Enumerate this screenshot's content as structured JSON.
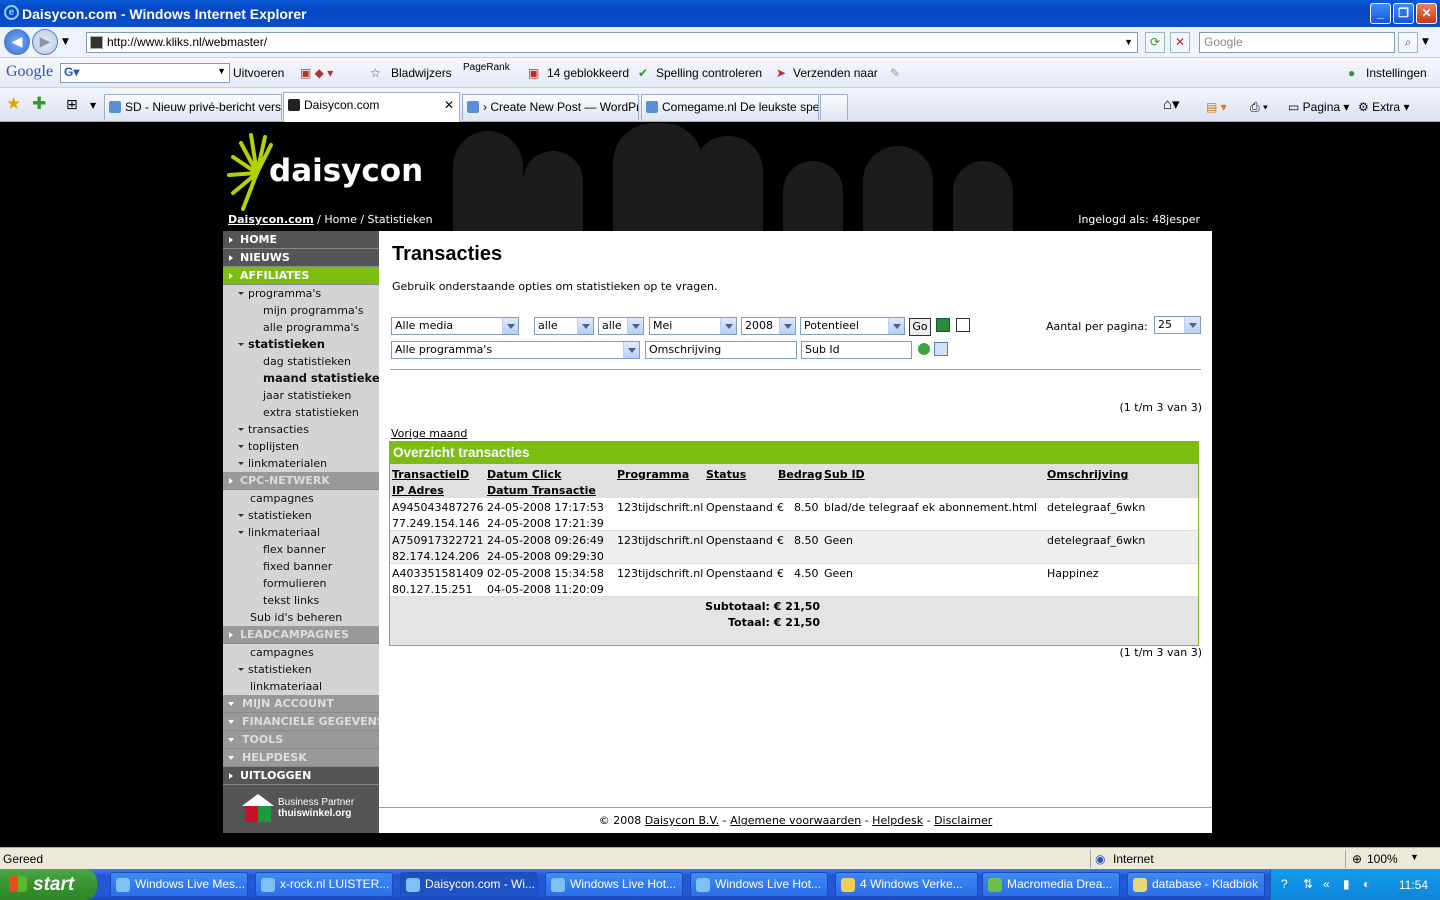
{
  "window": {
    "title": "Daisycon.com - Windows Internet Explorer",
    "url": "http://www.kliks.nl/webmaster/",
    "search_placeholder": "Google"
  },
  "google_toolbar": {
    "logo": "Google",
    "uitvoeren": "Uitvoeren",
    "bladwijzers": "Bladwijzers",
    "pagerank": "PageRank",
    "geblokkeerd": "14 geblokkeerd",
    "spelling": "Spelling controleren",
    "verzenden": "Verzenden naar",
    "instellingen": "Instellingen"
  },
  "tabs": [
    {
      "label": "SD - Nieuw privé-bericht vers..."
    },
    {
      "label": "Daisycon.com"
    },
    {
      "label": "› Create New Post — WordPr..."
    },
    {
      "label": "Comegame.nl De leukste spel..."
    }
  ],
  "tab_tools": {
    "pagina": "Pagina",
    "extra": "Extra"
  },
  "header": {
    "logo": "daisycon",
    "crumb_home_link": "Daisycon.com",
    "crumb_sep": " / ",
    "crumb_rest": "Home / Statistieken",
    "ingelogd": "Ingelogd als: 48jesper"
  },
  "sidebar": {
    "home": "HOME",
    "nieuws": "NIEUWS",
    "affiliates": "AFFILIATES",
    "programmas": "programma's",
    "mijn_programmas": "mijn programma's",
    "alle_programmas": "alle programma's",
    "statistieken": "statistieken",
    "dag": "dag statistieken",
    "maand": "maand statistieken",
    "jaar": "jaar statistieken",
    "extra": "extra statistieken",
    "transacties": "transacties",
    "toplijsten": "toplijsten",
    "linkmaterialen": "linkmaterialen",
    "cpc": "CPC-NETWERK",
    "cpc_campagnes": "campagnes",
    "cpc_statistieken": "statistieken",
    "cpc_linkmateriaal": "linkmateriaal",
    "flex": "flex banner",
    "fixed": "fixed banner",
    "formulieren": "formulieren",
    "tekst": "tekst links",
    "subid": "Sub id's beheren",
    "lead": "LEADCAMPAGNES",
    "lead_campagnes": "campagnes",
    "lead_statistieken": "statistieken",
    "lead_linkmateriaal": "linkmateriaal",
    "mijn_account": "MIJN ACCOUNT",
    "financiele": "FINANCIELE GEGEVENS",
    "tools": "TOOLS",
    "helpdesk": "HELPDESK",
    "uitloggen": "UITLOGGEN",
    "bp_line1": "Business Partner",
    "bp_line2": "thuiswinkel.org"
  },
  "content": {
    "title": "Transacties",
    "intro": "Gebruik onderstaande opties om statistieken op te vragen.",
    "filters": {
      "media": "Alle media",
      "alle1": "alle",
      "alle2": "alle",
      "maand": "Mei",
      "jaar": "2008",
      "status": "Potentieel",
      "go": "Go",
      "aantal_label": "Aantal per pagina:",
      "aantal": "25",
      "programma": "Alle programma's",
      "omschrijving": "Omschrijving",
      "subid": "Sub Id"
    },
    "count": "(1 t/m 3 van 3)",
    "vorige": "Vorige maand",
    "table_title": "Overzicht transacties",
    "headers": {
      "transactieid": "TransactieID",
      "datum_click": "Datum Click",
      "programma": "Programma",
      "status": "Status",
      "bedrag": "Bedrag",
      "sub_id": "Sub ID",
      "omschrijving": "Omschrijving",
      "ip": "IP Adres",
      "datum_transactie": "Datum Transactie"
    },
    "rows": [
      {
        "id": "A945043487276",
        "ip": "77.249.154.146",
        "click": "24-05-2008 17:17:53",
        "trans": "24-05-2008 17:21:39",
        "prog": "123tijdschrift.nl",
        "status": "Openstaand",
        "cur": "€",
        "amount": "8.50",
        "subid": "blad/de telegraaf ek abonnement.html",
        "omschr": "detelegraaf_6wkn"
      },
      {
        "id": "A750917322721",
        "ip": "82.174.124.206",
        "click": "24-05-2008 09:26:49",
        "trans": "24-05-2008 09:29:30",
        "prog": "123tijdschrift.nl",
        "status": "Openstaand",
        "cur": "€",
        "amount": "8.50",
        "subid": "Geen",
        "omschr": "detelegraaf_6wkn"
      },
      {
        "id": "A403351581409",
        "ip": "80.127.15.251",
        "click": "02-05-2008 15:34:58",
        "trans": "04-05-2008 11:20:09",
        "prog": "123tijdschrift.nl",
        "status": "Openstaand",
        "cur": "€",
        "amount": "4.50",
        "subid": "Geen",
        "omschr": "Happinez"
      }
    ],
    "subtotaal": "Subtotaal: € 21,50",
    "totaal": "Totaal: € 21,50",
    "footer": {
      "copy": "© 2008 ",
      "company": "Daisycon B.V.",
      "sep": " - ",
      "voorwaarden": "Algemene voorwaarden",
      "helpdesk": "Helpdesk",
      "disclaimer": "Disclaimer"
    }
  },
  "statusbar": {
    "left": "Gereed",
    "zone": "Internet",
    "zoom": "100%"
  },
  "taskbar": {
    "start": "start",
    "items": [
      "Windows Live Mes...",
      "x-rock.nl  LUISTER...",
      "Daisycon.com - Wi...",
      "Windows Live Hot...",
      "Windows Live Hot...",
      "4 Windows Verke...",
      "Macromedia Drea...",
      "database - Kladblok"
    ],
    "clock": "11:54"
  }
}
